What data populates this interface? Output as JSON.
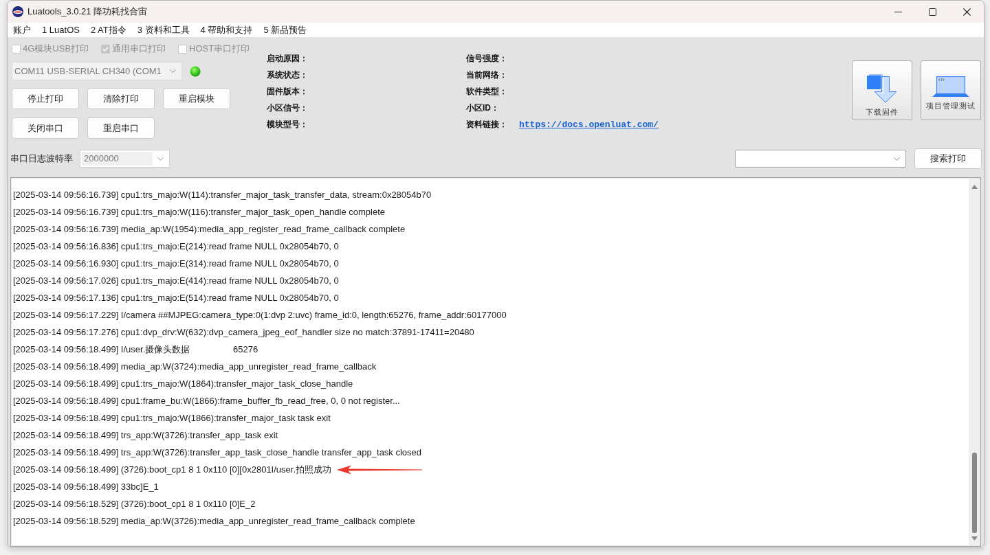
{
  "window": {
    "title": "Luatools_3.0.21 降功耗找合宙"
  },
  "menu": [
    "账户",
    "1 LuatOS",
    "2 AT指令",
    "3 资料和工具",
    "4 帮助和支持",
    "5 新品预告"
  ],
  "print_options": [
    {
      "label": "4G模块USB打印",
      "checked": false,
      "disabled": true
    },
    {
      "label": "通用串口打印",
      "checked": true,
      "disabled": true
    },
    {
      "label": "HOST串口打印",
      "checked": false,
      "disabled": true
    }
  ],
  "port": {
    "value": "COM11 USB-SERIAL CH340 (COM1",
    "connected": true
  },
  "buttons": [
    "停止打印",
    "清除打印",
    "重启模块",
    "关闭串口",
    "重启串口"
  ],
  "info": [
    {
      "label": "启动原因："
    },
    {
      "label": "信号强度："
    },
    {
      "label": "系统状态："
    },
    {
      "label": "当前网络："
    },
    {
      "label": "固件版本："
    },
    {
      "label": "软件类型："
    },
    {
      "label": "小区信号："
    },
    {
      "label": "小区ID："
    },
    {
      "label": "模块型号："
    },
    {
      "label": "资料链接：",
      "link": "https://docs.openluat.com/"
    }
  ],
  "tools": [
    {
      "label": "下载固件",
      "kind": "download"
    },
    {
      "label": "项目管理测试",
      "kind": "laptop"
    }
  ],
  "baud": {
    "label": "串口日志波特率",
    "value": "2000000"
  },
  "search": {
    "button": "搜索打印"
  },
  "log": {
    "lines": [
      {
        "text": "[2025-03-14 09:56:16.739] cpu1:trs_majo:W(114):transfer_major_task_transfer_data, stream:0x28054b70",
        "arrow": false
      },
      {
        "text": "[2025-03-14 09:56:16.739] cpu1:trs_majo:W(116):transfer_major_task_open_handle complete",
        "arrow": false
      },
      {
        "text": "[2025-03-14 09:56:16.739] media_ap:W(1954):media_app_register_read_frame_callback complete",
        "arrow": false
      },
      {
        "text": "[2025-03-14 09:56:16.836] cpu1:trs_majo:E(214):read frame NULL 0x28054b70, 0",
        "arrow": false
      },
      {
        "text": "[2025-03-14 09:56:16.930] cpu1:trs_majo:E(314):read frame NULL 0x28054b70, 0",
        "arrow": false
      },
      {
        "text": "[2025-03-14 09:56:17.026] cpu1:trs_majo:E(414):read frame NULL 0x28054b70, 0",
        "arrow": false
      },
      {
        "text": "[2025-03-14 09:56:17.136] cpu1:trs_majo:E(514):read frame NULL 0x28054b70, 0",
        "arrow": false
      },
      {
        "text": "[2025-03-14 09:56:17.229] I/camera ##MJPEG:camera_type:0(1:dvp 2:uvc) frame_id:0, length:65276, frame_addr:60177000",
        "arrow": false
      },
      {
        "text": "[2025-03-14 09:56:17.276] cpu1:dvp_drv:W(632):dvp_camera_jpeg_eof_handler size no match:37891-17411=20480",
        "arrow": false
      },
      {
        "text": "[2025-03-14 09:56:18.499] I/user.摄像头数据\t65276",
        "arrow": false
      },
      {
        "text": "[2025-03-14 09:56:18.499] media_ap:W(3724):media_app_unregister_read_frame_callback",
        "arrow": false
      },
      {
        "text": "[2025-03-14 09:56:18.499] cpu1:trs_majo:W(1864):transfer_major_task_close_handle",
        "arrow": false
      },
      {
        "text": "[2025-03-14 09:56:18.499] cpu1:frame_bu:W(1866):frame_buffer_fb_read_free, 0, 0 not register...",
        "arrow": false
      },
      {
        "text": "[2025-03-14 09:56:18.499] cpu1:trs_majo:W(1866):transfer_major_task task exit",
        "arrow": false
      },
      {
        "text": "[2025-03-14 09:56:18.499] trs_app:W(3726):transfer_app_task exit",
        "arrow": false
      },
      {
        "text": "[2025-03-14 09:56:18.499] trs_app:W(3726):transfer_app_task_close_handle transfer_app_task closed",
        "arrow": false
      },
      {
        "text": "[2025-03-14 09:56:18.499] (3726):boot_cp1 8 1 0x110 [0][0x2801I/user.拍照成功",
        "arrow": true
      },
      {
        "text": "[2025-03-14 09:56:18.499] 33bc]E_1",
        "arrow": false
      },
      {
        "text": "[2025-03-14 09:56:18.529] (3726):boot_cp1 8 1 0x110 [0]E_2",
        "arrow": false
      },
      {
        "text": "[2025-03-14 09:56:18.529] media_ap:W(3726):media_app_unregister_read_frame_callback complete",
        "arrow": false
      }
    ]
  }
}
